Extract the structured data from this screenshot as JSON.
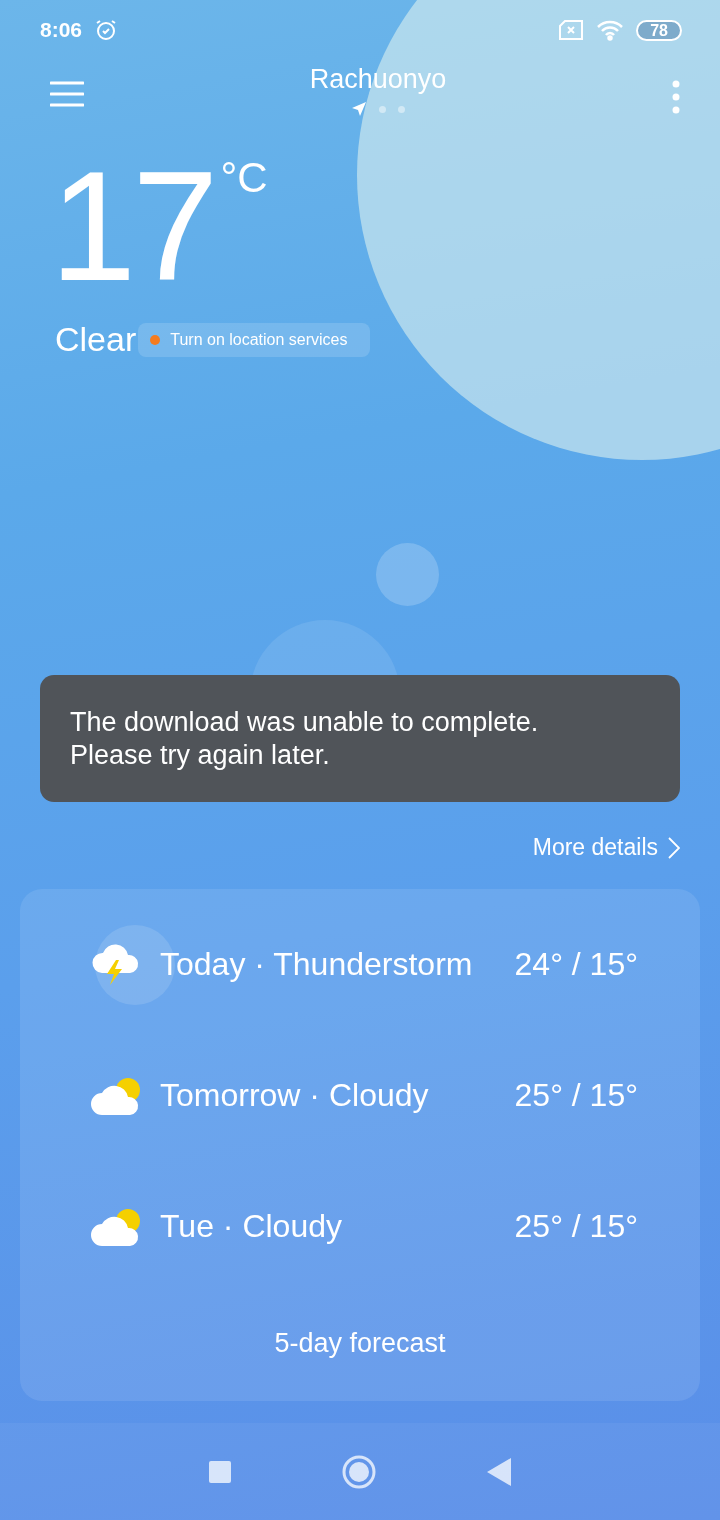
{
  "status_bar": {
    "time": "8:06",
    "alarm": true,
    "battery": "78"
  },
  "header": {
    "city": "Rachuonyo",
    "pages": [
      {
        "kind": "location",
        "selected": true
      },
      {
        "kind": "dot",
        "selected": false
      },
      {
        "kind": "dot",
        "selected": false
      }
    ]
  },
  "current": {
    "temperature": "17",
    "unit": "°C",
    "condition": "Clear",
    "location_notice": {
      "text": "Turn on location services",
      "color": "#f57c1f"
    }
  },
  "toast": {
    "message": "The download was unable to complete. Please try again later."
  },
  "more_details": "More details",
  "forecast": {
    "days": [
      {
        "kind": "storm",
        "label": "Today · Thunderstorm",
        "temps": "24° / 15°"
      },
      {
        "kind": "cloudy",
        "label": "Tomorrow · Cloudy",
        "temps": "25° / 15°"
      },
      {
        "kind": "cloudy",
        "label": "Tue · Cloudy",
        "temps": "25° / 15°"
      }
    ],
    "button": "5-day forecast"
  }
}
